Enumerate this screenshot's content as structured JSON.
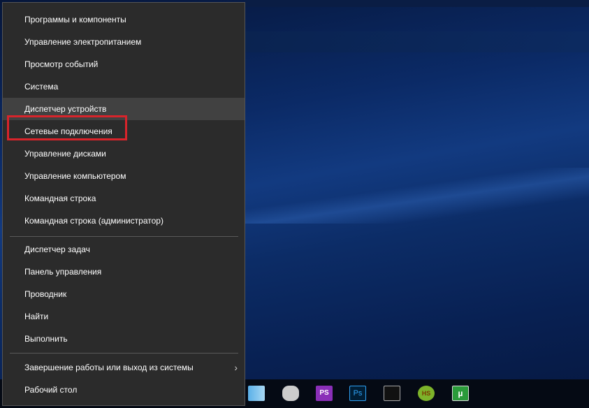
{
  "menu": {
    "group1": [
      "Программы и компоненты",
      "Управление электропитанием",
      "Просмотр событий",
      "Система",
      "Диспетчер устройств",
      "Сетевые подключения",
      "Управление дисками",
      "Управление компьютером",
      "Командная строка",
      "Командная строка (администратор)"
    ],
    "group2": [
      "Диспетчер задач",
      "Панель управления",
      "Проводник",
      "Найти",
      "Выполнить"
    ],
    "group3": [
      "Завершение работы или выход из системы",
      "Рабочий стол"
    ],
    "highlighted": "Диспетчер устройств",
    "annotated": "Сетевые подключения"
  },
  "taskbar": {
    "icons": [
      "explorer-icon",
      "app-icon",
      "phpstorm-icon",
      "photoshop-icon",
      "cmd-icon",
      "heidisql-icon",
      "utorrent-icon"
    ]
  },
  "colors": {
    "annotation": "#d8242b",
    "menu_bg": "#2b2b2b"
  }
}
